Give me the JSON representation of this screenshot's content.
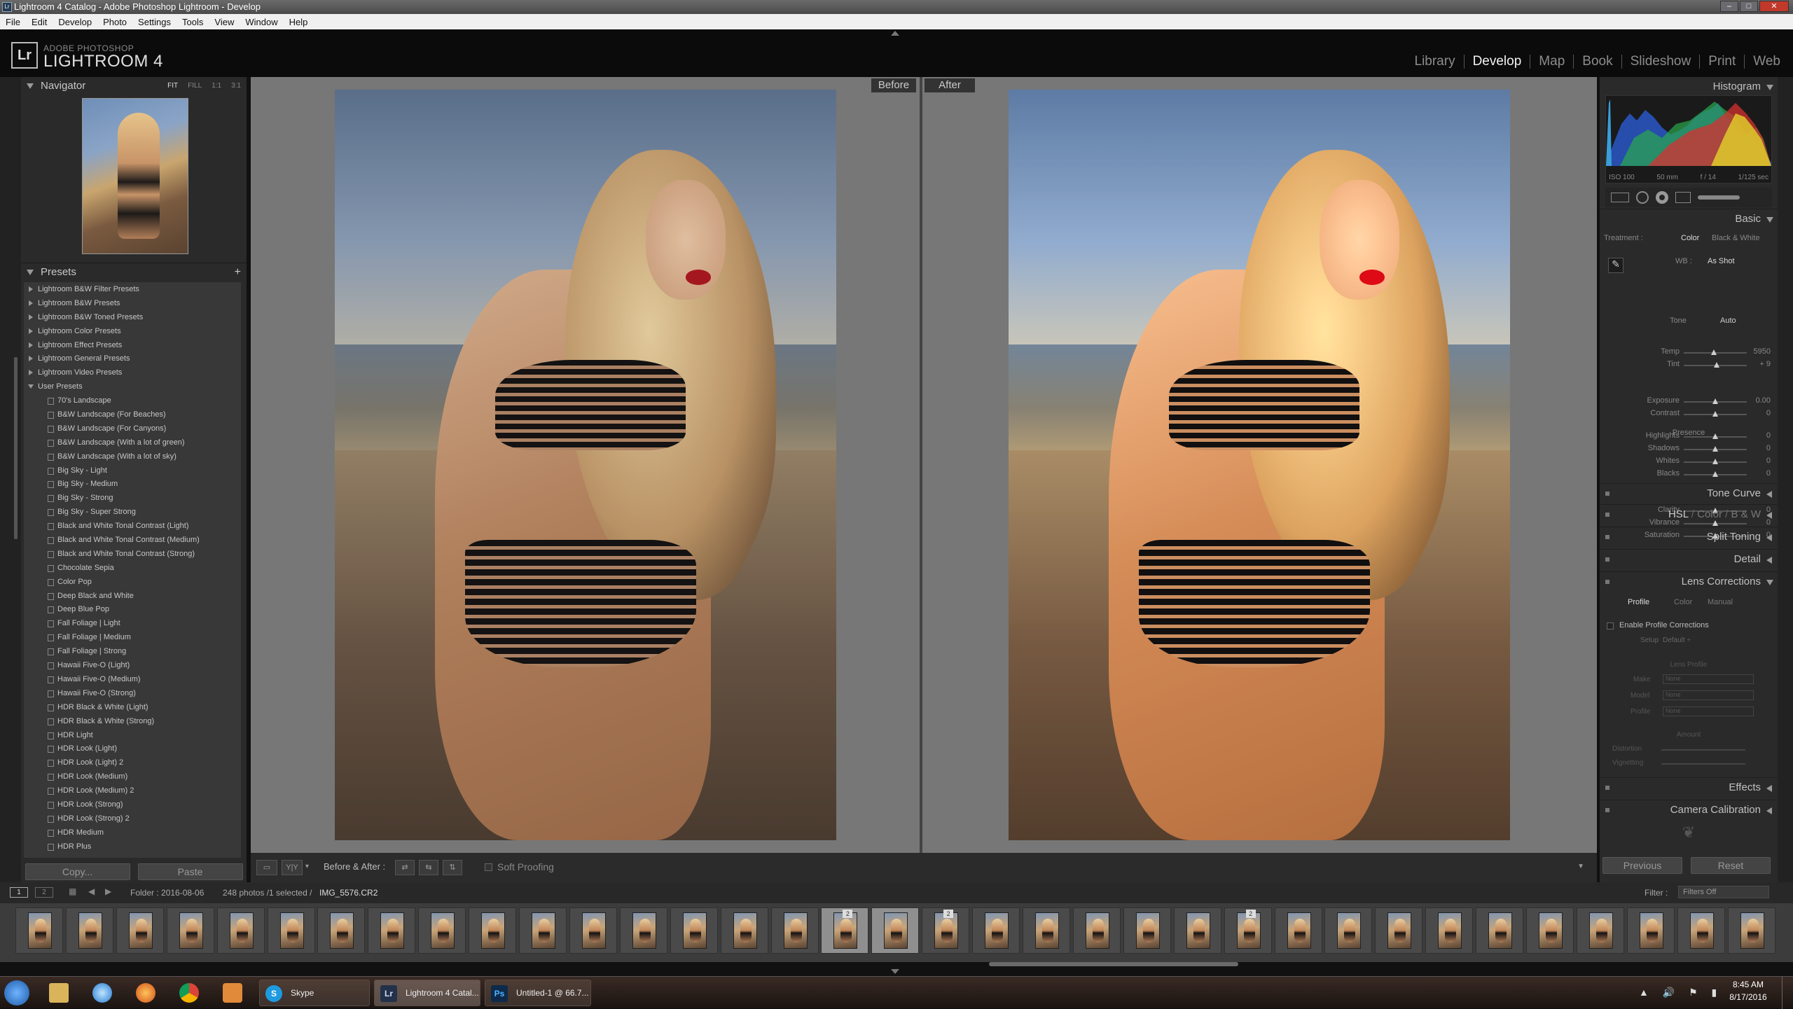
{
  "window": {
    "title": "Lightroom 4 Catalog - Adobe Photoshop Lightroom - Develop"
  },
  "menu": [
    "File",
    "Edit",
    "Develop",
    "Photo",
    "Settings",
    "Tools",
    "View",
    "Window",
    "Help"
  ],
  "brand": {
    "top": "ADOBE PHOTOSHOP",
    "main": "LIGHTROOM 4",
    "logo": "Lr"
  },
  "modules": [
    "Library",
    "Develop",
    "Map",
    "Book",
    "Slideshow",
    "Print",
    "Web"
  ],
  "active_module": "Develop",
  "navigator": {
    "title": "Navigator",
    "options": [
      "FIT",
      "FILL",
      "1:1",
      "3:1"
    ]
  },
  "presets": {
    "title": "Presets",
    "folders": [
      "Lightroom B&W Filter Presets",
      "Lightroom B&W Presets",
      "Lightroom B&W Toned Presets",
      "Lightroom Color Presets",
      "Lightroom Effect Presets",
      "Lightroom General Presets",
      "Lightroom Video Presets",
      "User Presets"
    ],
    "user_presets": [
      "70's Landscape",
      "B&W Landscape (For Beaches)",
      "B&W Landscape (For Canyons)",
      "B&W Landscape (With a lot of green)",
      "B&W Landscape (With a lot of sky)",
      "Big Sky - Light",
      "Big Sky - Medium",
      "Big Sky - Strong",
      "Big Sky - Super Strong",
      "Black and White Tonal Contrast (Light)",
      "Black and White Tonal Contrast (Medium)",
      "Black and White Tonal Contrast (Strong)",
      "Chocolate Sepia",
      "Color Pop",
      "Deep Black and White",
      "Deep Blue Pop",
      "Fall Foliage | Light",
      "Fall Foliage | Medium",
      "Fall Foliage | Strong",
      "Hawaii Five-O (Light)",
      "Hawaii Five-O (Medium)",
      "Hawaii Five-O (Strong)",
      "HDR Black & White (Light)",
      "HDR Black & White (Strong)",
      "HDR Light",
      "HDR Look (Light)",
      "HDR Look (Light) 2",
      "HDR Look (Medium)",
      "HDR Look (Medium) 2",
      "HDR Look (Strong)",
      "HDR Look (Strong) 2",
      "HDR Medium",
      "HDR Plus"
    ]
  },
  "copy_label": "Copy...",
  "paste_label": "Paste",
  "view": {
    "before": "Before",
    "after": "After"
  },
  "toolbar": {
    "before_after": "Before & After :",
    "soft_proofing": "Soft Proofing",
    "yy": "Y|Y"
  },
  "histogram": {
    "title": "Histogram",
    "iso": "ISO 100",
    "focal": "50 mm",
    "aperture": "f / 14",
    "shutter": "1/125 sec"
  },
  "basic": {
    "title": "Basic",
    "treatment_label": "Treatment :",
    "color": "Color",
    "bw": "Black & White",
    "wb_label": "WB :",
    "wb_value": "As Shot",
    "sliders": [
      {
        "label": "Temp",
        "value": "5950",
        "pos": 0.48,
        "group": "wb"
      },
      {
        "label": "Tint",
        "value": "+ 9",
        "pos": 0.52,
        "group": "wb"
      },
      {
        "label": "Exposure",
        "value": "0.00",
        "pos": 0.5,
        "group": "tone"
      },
      {
        "label": "Contrast",
        "value": "0",
        "pos": 0.5,
        "group": "tone"
      },
      {
        "label": "Highlights",
        "value": "0",
        "pos": 0.5,
        "group": "tone2"
      },
      {
        "label": "Shadows",
        "value": "0",
        "pos": 0.5,
        "group": "tone2"
      },
      {
        "label": "Whites",
        "value": "0",
        "pos": 0.5,
        "group": "tone2"
      },
      {
        "label": "Blacks",
        "value": "0",
        "pos": 0.5,
        "group": "tone2"
      },
      {
        "label": "Clarity",
        "value": "0",
        "pos": 0.5,
        "group": "presence"
      },
      {
        "label": "Vibrance",
        "value": "0",
        "pos": 0.5,
        "group": "presence"
      },
      {
        "label": "Saturation",
        "value": "0",
        "pos": 0.5,
        "group": "presence"
      }
    ],
    "tone": "Tone",
    "auto": "Auto",
    "presence": "Presence"
  },
  "right_panels": {
    "tone_curve": "Tone Curve",
    "hsl": "HSL",
    "hsl_color": "Color",
    "hsl_bw": "B & W",
    "split_toning": "Split Toning",
    "detail": "Detail",
    "lens": "Lens Corrections",
    "effects": "Effects",
    "calibration": "Camera Calibration"
  },
  "lens": {
    "tabs": [
      "Profile",
      "Color",
      "Manual"
    ],
    "enable": "Enable Profile Corrections",
    "setup_label": "Setup",
    "setup_value": "Default ÷",
    "lens_profile": "Lens Profile",
    "make": "Make",
    "model": "Model",
    "profile": "Profile",
    "none": "None",
    "amount": "Amount",
    "distortion": "Distortion",
    "vignetting": "Vignetting"
  },
  "prev_label": "Previous",
  "reset_label": "Reset",
  "filmbar": {
    "folder": "Folder : 2016-08-06",
    "info": "248 photos /1 selected /",
    "file": "IMG_5576.CR2",
    "filter_label": "Filter :",
    "filter_value": "Filters Off",
    "p1": "1",
    "p2": "2"
  },
  "film_badges": [
    {
      "i": 16,
      "text": "2"
    },
    {
      "i": 18,
      "text": "2"
    },
    {
      "i": 24,
      "text": "2"
    }
  ],
  "taskbar": {
    "skype": "Skype",
    "lightroom": "Lightroom 4 Catal...",
    "photoshop": "Untitled-1 @ 66.7...",
    "time": "8:45 AM",
    "date": "8/17/2016"
  }
}
